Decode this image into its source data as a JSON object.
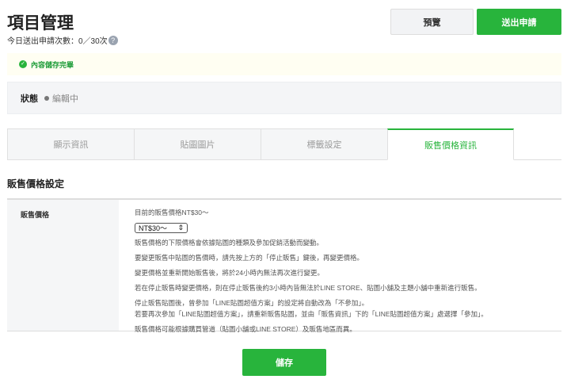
{
  "header": {
    "title": "項目管理",
    "submit_count_label": "今日送出申請次數：",
    "submit_count": "0／30次",
    "help": "?",
    "preview": "預覽",
    "submit": "送出申請"
  },
  "notice": {
    "icon": "check-circle-icon",
    "text": "內容儲存完畢"
  },
  "status": {
    "label": "狀態",
    "value": "編輯中"
  },
  "tabs": [
    {
      "label": "顯示資訊"
    },
    {
      "label": "貼圖圖片"
    },
    {
      "label": "標籤設定"
    },
    {
      "label": "販售價格資訊"
    }
  ],
  "section": {
    "title": "販售價格設定",
    "row_label": "販售價格",
    "current": "目前的販售價格NT$30～",
    "select_value": "NT$30～",
    "notes": [
      "販售價格的下限價格會依據貼圖的種類及參加促銷活動而變動。",
      "要變更販售中貼圖的售價時，請先按上方的「停止販售」鍵後，再變更價格。",
      "變更價格並重新開始販售後，將於24小時內無法再次進行變更。",
      "若在停止販售時變更價格，則在停止販售後約3小時內皆無法於LINE STORE、貼圖小舖及主題小舖中重新進行販售。",
      "停止販售貼圖後，曾參加「LINE貼圖超值方案」的設定將自動改為「不參加」。",
      "若要再次參加「LINE貼圖超值方案」，請重新販售貼圖，並由「販售資訊」下的「LINE貼圖超值方案」處選擇「參加」。",
      "販售價格可能根據購買管道（貼圖小舖或LINE STORE）及販售地區而異。"
    ]
  },
  "save": "儲存"
}
